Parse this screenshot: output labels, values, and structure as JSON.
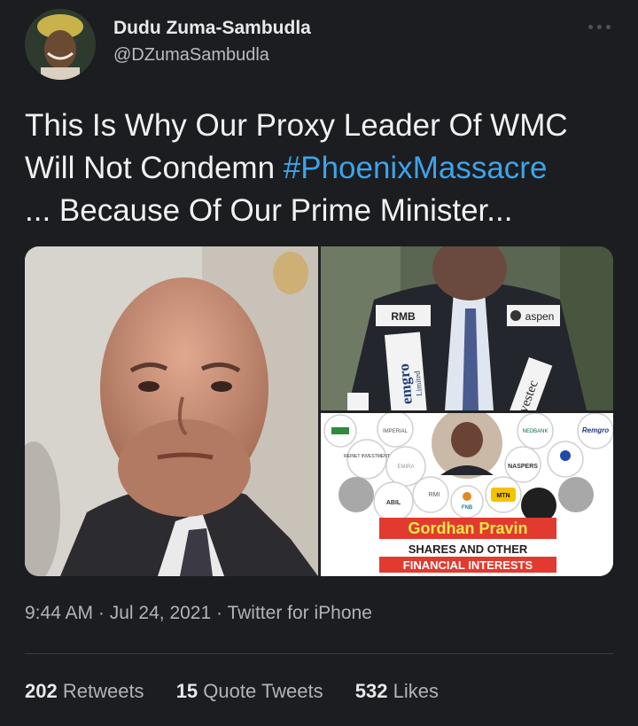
{
  "author": {
    "display_name": "Dudu Zuma-Sambudla",
    "handle": "@DZumaSambudla"
  },
  "tweet": {
    "text_line1": "This Is Why Our Proxy Leader Of WMC",
    "text_line2_prefix": "Will Not Condemn ",
    "hashtag": "#PhoenixMassacre",
    "text_line3": "... Because Of Our Prime Minister..."
  },
  "media": {
    "logos": {
      "rmb": "RMB",
      "aspen": "aspen",
      "remgro": "emgro",
      "remgro_sub": "Limited",
      "investec": "nvestec",
      "imperial": "IMPERIAL",
      "nedbank": "NEDBANK",
      "remgro2": "Remgro",
      "reinet": "REINET INVESTMENT",
      "emira": "EMIRA",
      "naspers": "NASPERS",
      "abil": "ABIL",
      "rmi": "RMI",
      "fnb": "FNB",
      "mtn": "MTN"
    },
    "infographic": {
      "title": "Gordhan Pravin",
      "line1": "SHARES AND OTHER",
      "line2": "FINANCIAL INTERESTS"
    }
  },
  "meta": {
    "time": "9:44 AM",
    "date": "Jul 24, 2021",
    "source": "Twitter for iPhone"
  },
  "stats": {
    "retweets_count": "202",
    "retweets_label": "Retweets",
    "quotes_count": "15",
    "quotes_label": "Quote Tweets",
    "likes_count": "532",
    "likes_label": "Likes"
  },
  "colors": {
    "background": "#1b1d20",
    "hashtag": "#3ea3ea",
    "muted": "#b0b4b8",
    "banner_red": "#e23a2f"
  }
}
